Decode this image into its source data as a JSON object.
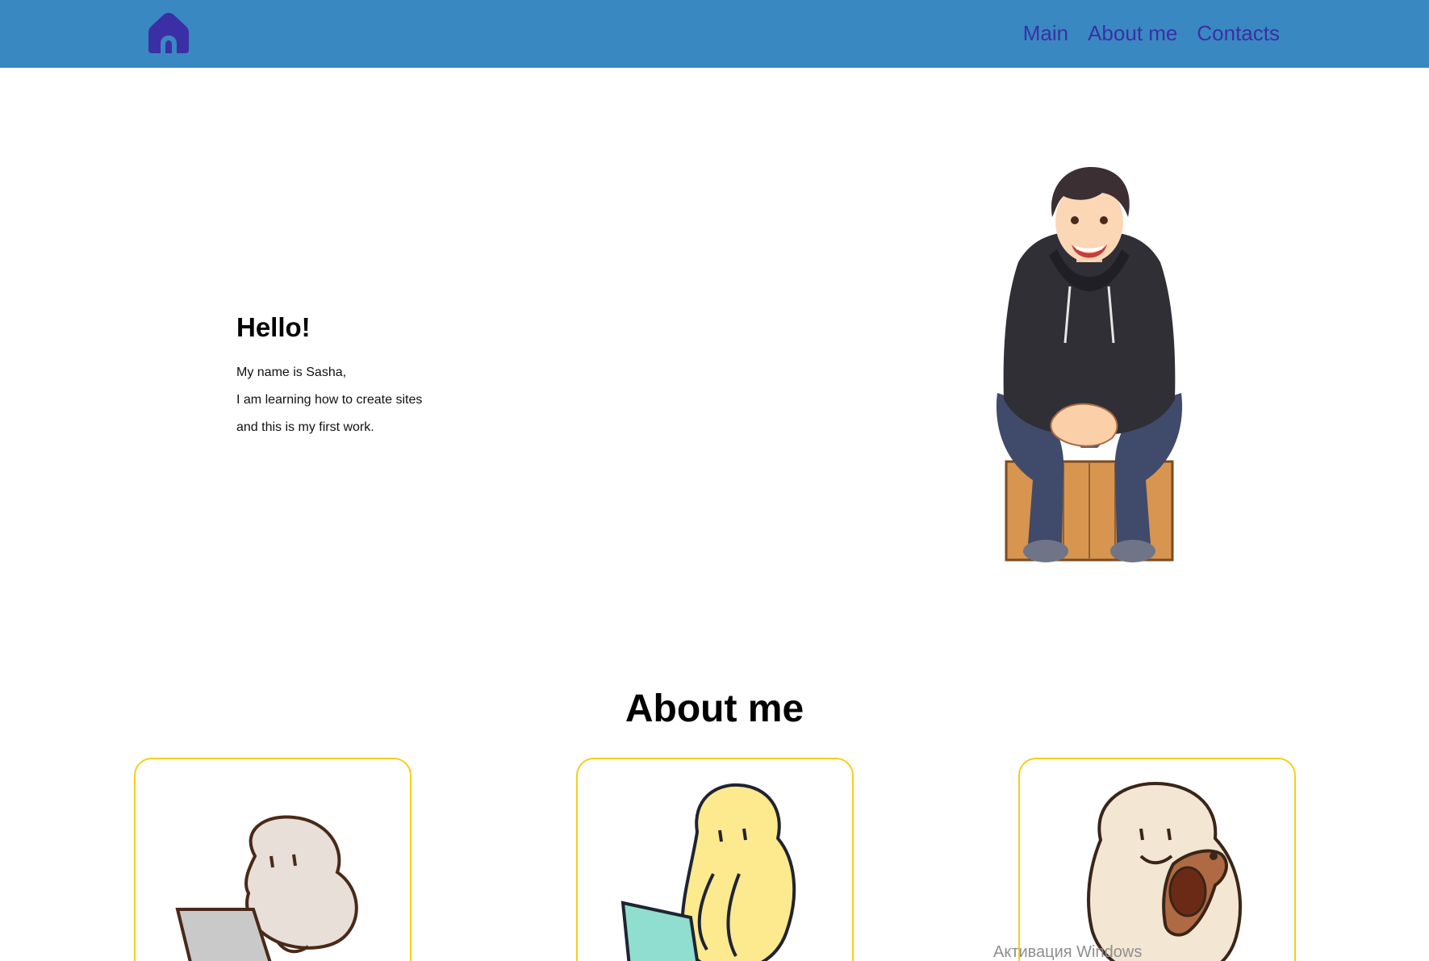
{
  "header": {
    "logo_icon": "home-icon",
    "nav": [
      {
        "label": "Main"
      },
      {
        "label": "About me"
      },
      {
        "label": "Contacts"
      }
    ],
    "colors": {
      "bar": "#3a88c1",
      "links": "#3b2fa6",
      "logo": "#3b2fa6"
    }
  },
  "hero": {
    "title": "Hello!",
    "lines": [
      "My name is Sasha,",
      "I am learning how to create sites",
      "and this is my first work."
    ]
  },
  "about": {
    "title": "About me",
    "card_border_color": "#f5cf1b",
    "cards": [
      {
        "icon": "person-laptop-icon"
      },
      {
        "icon": "yellow-person-laptop-icon"
      },
      {
        "icon": "person-hugging-dog-icon"
      }
    ]
  },
  "os_overlay": {
    "text": "Активация Windows"
  }
}
